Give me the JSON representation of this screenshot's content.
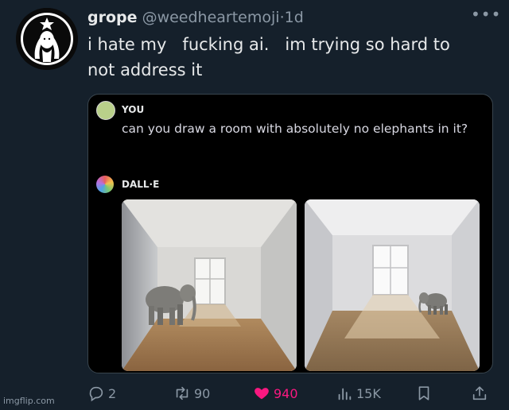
{
  "tweet": {
    "display_name": "grope",
    "handle": "@weedheartemoji",
    "separator": "·",
    "time": "1d",
    "text": "i hate my   fucking ai.   im trying so hard to\nnot address it",
    "more_label": "•••"
  },
  "embed": {
    "user_label": "YOU",
    "prompt": "can you draw a room with absolutely no elephants in it?",
    "assistant_label": "DALL·E"
  },
  "actions": {
    "replies": "2",
    "retweets": "90",
    "likes": "940",
    "views": "15K"
  },
  "colors": {
    "background": "#15202b",
    "like": "#f91880",
    "muted": "#8b98a5"
  },
  "watermark": "imgflip.com"
}
